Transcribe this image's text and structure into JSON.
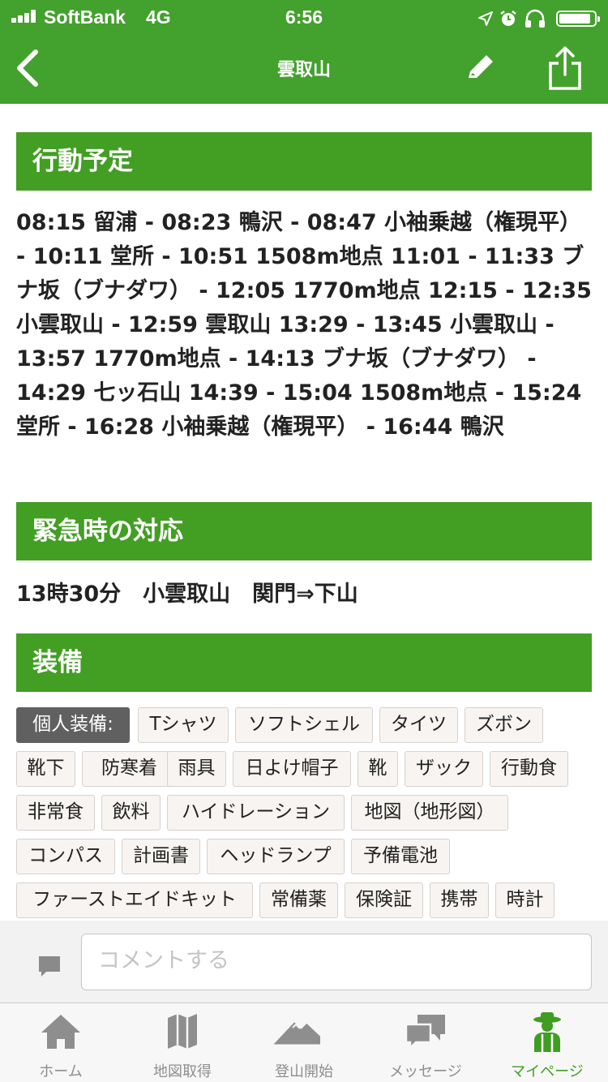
{
  "status_bar": {
    "carrier": "SoftBank",
    "network": "4G",
    "time": "6:56"
  },
  "nav": {
    "title": "雲取山",
    "back_icon": "chevron-left-icon",
    "edit_icon": "pencil-icon",
    "share_icon": "share-icon"
  },
  "sections": {
    "plan": {
      "heading": "行動予定",
      "body": "08:15 留浦 - 08:23 鴨沢 - 08:47 小袖乗越（権現平） - 10:11 堂所 - 10:51 1508m地点 11:01 - 11:33 ブナ坂（ブナダワ） - 12:05 1770m地点 12:15 - 12:35 小雲取山 - 12:59 雲取山 13:29 - 13:45 小雲取山 - 13:57 1770m地点 - 14:13 ブナ坂（ブナダワ） - 14:29 七ッ石山 14:39 - 15:04 1508m地点 - 15:24 堂所 - 16:28 小袖乗越（権現平） - 16:44 鴨沢"
    },
    "emergency": {
      "heading": "緊急時の対応",
      "body": "13時30分　小雲取山　関門⇒下山"
    },
    "equipment": {
      "heading": "装備",
      "category_label": "個人装備:",
      "items": [
        "Tシャツ",
        "ソフトシェル",
        "タイツ",
        "ズボン",
        "靴下",
        "防寒着",
        "雨具",
        "日よけ帽子",
        "靴",
        "ザック",
        "行動食",
        "非常食",
        "飲料",
        "ハイドレーション",
        "地図（地形図）",
        "コンパス",
        "計画書",
        "ヘッドランプ",
        "予備電池",
        "ファーストエイドキット",
        "常備薬",
        "保険証",
        "携帯",
        "時計"
      ]
    }
  },
  "comment": {
    "placeholder": "コメントする",
    "icon": "speech-bubble-icon"
  },
  "tab_bar": {
    "items": [
      {
        "label": "ホーム",
        "icon": "home-icon"
      },
      {
        "label": "地図取得",
        "icon": "map-icon"
      },
      {
        "label": "登山開始",
        "icon": "mountain-icon"
      },
      {
        "label": "メッセージ",
        "icon": "chat-bubbles-icon"
      },
      {
        "label": "マイページ",
        "icon": "hiker-icon",
        "active": true
      }
    ]
  },
  "colors": {
    "brand_green": "#43a12d",
    "section_green": "#439e24",
    "tag_label_gray": "#606060"
  }
}
